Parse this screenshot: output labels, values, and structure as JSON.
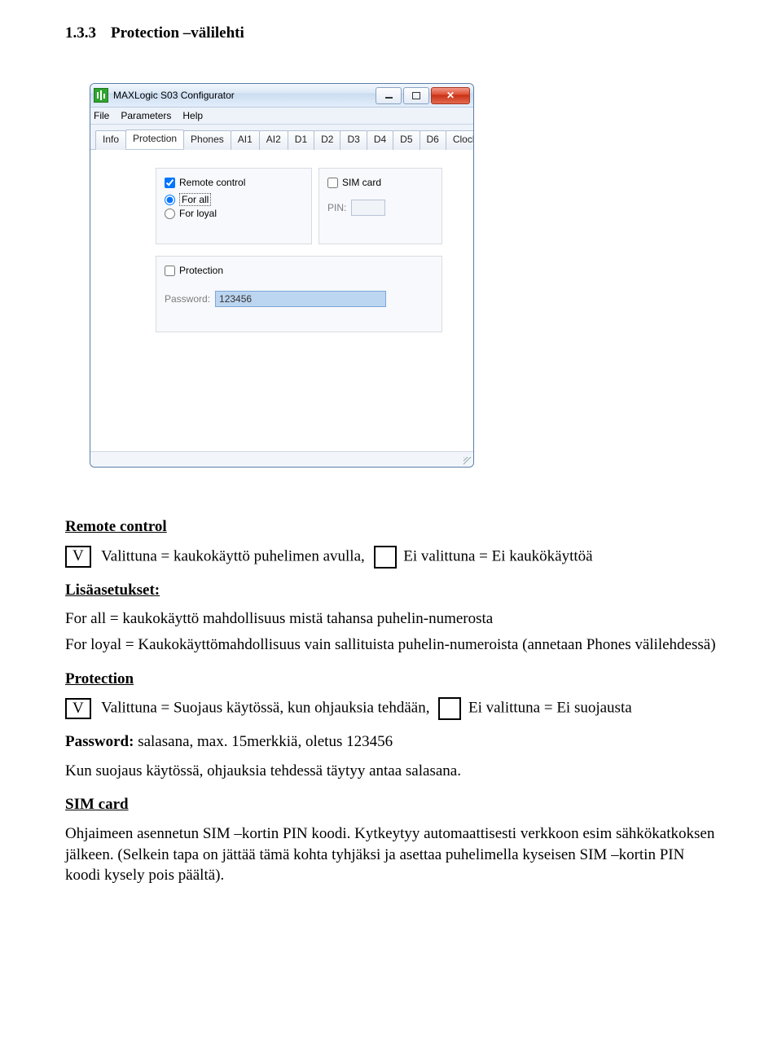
{
  "doc": {
    "section_no": "1.3.3",
    "section_title": "Protection –välilehti",
    "remote_heading": "Remote control",
    "v_label": "V",
    "remote_line_valittuna": "Valittuna = kaukokäyttö puhelimen avulla,",
    "remote_line_eivalittuna": "Ei valittuna = Ei kaukökäyttöä",
    "lisa_heading": "Lisäasetukset:",
    "forall_text": "For all = kaukokäyttö mahdollisuus mistä tahansa puhelin-numerosta",
    "forloyal_text": "For loyal = Kaukokäyttömahdollisuus vain sallituista puhelin-numeroista (annetaan Phones välilehdessä)",
    "protection_heading": "Protection",
    "protection_valittuna": "Valittuna =  Suojaus käytössä, kun ohjauksia tehdään,",
    "protection_eivalittuna": "Ei valittuna = Ei suojausta",
    "password_bold": "Password:",
    "password_rest": " salasana, max. 15merkkiä, oletus 123456",
    "protection_extra": "Kun suojaus käytössä, ohjauksia tehdessä täytyy antaa salasana.",
    "sim_heading": "SIM card",
    "sim_text": "Ohjaimeen asennetun SIM –kortin PIN koodi. Kytkeytyy automaattisesti verkkoon esim sähkökatkoksen jälkeen. (Selkein tapa on jättää tämä kohta tyhjäksi ja asettaa puhelimella kyseisen SIM –kortin PIN koodi kysely pois päältä)."
  },
  "app": {
    "title": "MAXLogic S03 Configurator",
    "menus": [
      "File",
      "Parameters",
      "Help"
    ],
    "tabs": [
      "Info",
      "Protection",
      "Phones",
      "AI1",
      "AI2",
      "D1",
      "D2",
      "D3",
      "D4",
      "D5",
      "D6",
      "Clock"
    ],
    "active_tab": "Protection",
    "remote_control_label": "Remote control",
    "remote_checked": true,
    "radio_for_all": "For all",
    "radio_for_loyal": "For loyal",
    "sim_card_label": "SIM card",
    "pin_label": "PIN:",
    "pin_value": "",
    "protection_label": "Protection",
    "protection_checked": false,
    "password_label": "Password:",
    "password_value": "123456"
  }
}
